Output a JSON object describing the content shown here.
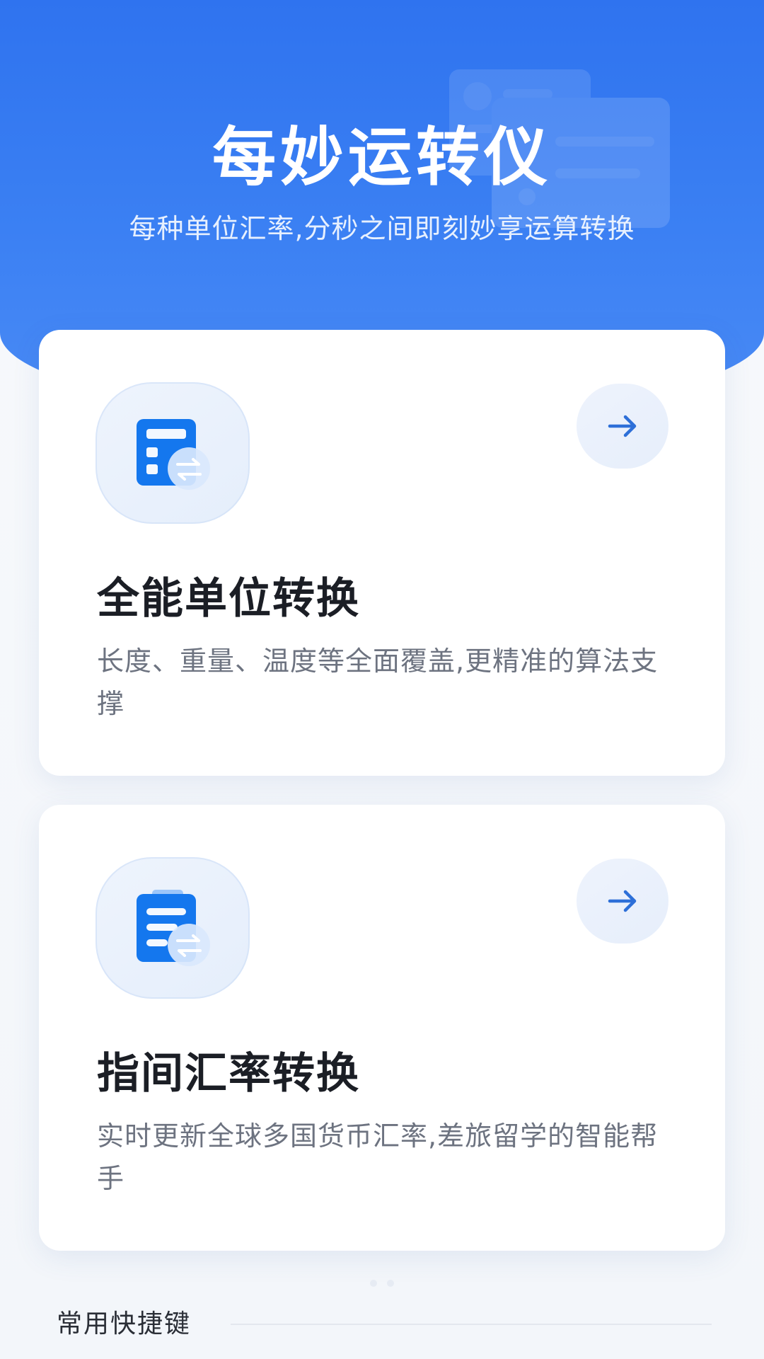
{
  "hero": {
    "title": "每妙运转仪",
    "subtitle": "每种单位汇率,分秒之间即刻妙享运算转换"
  },
  "cards": [
    {
      "icon": "calculator-swap-icon",
      "title": "全能单位转换",
      "description": "长度、重量、温度等全面覆盖,更精准的算法支撑",
      "action_icon": "arrow-right-icon"
    },
    {
      "icon": "document-swap-icon",
      "title": "指间汇率转换",
      "description": "实时更新全球多国货币汇率,差旅留学的智能帮手",
      "action_icon": "arrow-right-icon"
    }
  ],
  "pager": {
    "pages": 2,
    "current": 1
  },
  "shortcuts": {
    "title": "常用快捷键"
  },
  "colors": {
    "brand_blue": "#2f73ef",
    "icon_blue": "#1477ee",
    "arrow_blue": "#2d6fd8",
    "card_bg": "#ffffff",
    "title_text": "#1b1e25",
    "desc_text": "#6d7380"
  }
}
